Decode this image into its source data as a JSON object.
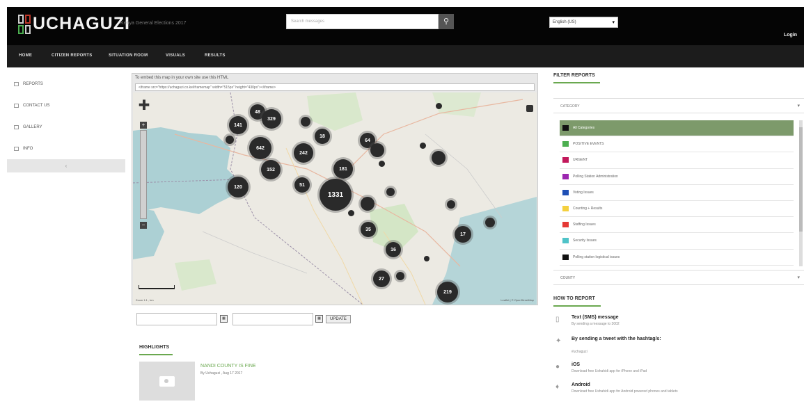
{
  "header": {
    "logo_text": "UCHAGUZI",
    "tagline": "Kenya General Elections 2017",
    "search_placeholder": "Search messages",
    "search_icon": "search-icon",
    "language": "English (US)",
    "login": "Login"
  },
  "nav": [
    {
      "label": "HOME"
    },
    {
      "label": "CITIZEN REPORTS"
    },
    {
      "label": "SITUATION ROOM"
    },
    {
      "label": "VISUALS"
    },
    {
      "label": "RESULTS"
    }
  ],
  "sidebar": [
    {
      "label": "REPORTS"
    },
    {
      "label": "CONTACT US"
    },
    {
      "label": "GALLERY"
    },
    {
      "label": "INFO"
    }
  ],
  "map": {
    "embed_text": "To embed this map in your own site use this HTML",
    "embed_code": "<iframe src=\"https://uchaguzi.co.ke/iframemap\" width=\"515px\" height=\"430px\"></iframe>",
    "clusters": [
      "48",
      "329",
      "141",
      "642",
      "242",
      "152",
      "181",
      "120",
      "1331",
      "64",
      "18",
      "51",
      "35",
      "16",
      "27",
      "219",
      "17"
    ],
    "footer_left": "Zoom 1:1 , km",
    "footer_right": "Leaflet | © OpenStreetMap"
  },
  "date_filter": {
    "update_label": "UPDATE"
  },
  "highlights": {
    "title": "HIGHLIGHTS",
    "item_title": "NANDI COUNTY IS FINE",
    "item_meta": "By Uchaguzi , Aug 17 2017"
  },
  "filter": {
    "title": "FILTER REPORTS",
    "category_label": "CATEGORY",
    "categories": [
      {
        "label": "All Categories",
        "color": "#111111"
      },
      {
        "label": "POSITIVE EVENTS",
        "color": "#4caf50"
      },
      {
        "label": "URGENT",
        "color": "#c2185b"
      },
      {
        "label": "Polling Station Administration",
        "color": "#9c27b0"
      },
      {
        "label": "Voting Issues",
        "color": "#1e4fb5"
      },
      {
        "label": "Counting + Results",
        "color": "#f4d03f"
      },
      {
        "label": "Staffing Issues",
        "color": "#e53935"
      },
      {
        "label": "Security Issues",
        "color": "#4fc3c8"
      },
      {
        "label": "Polling station logistical issues",
        "color": "#111111"
      }
    ],
    "county_label": "COUNTY"
  },
  "howto": {
    "title": "HOW TO REPORT",
    "items": [
      {
        "title": "Text (SMS) message",
        "sub": "By sending a message to 3002",
        "icon": "phone-icon"
      },
      {
        "title": "By sending a tweet with the hashtag/s:",
        "sub": "#uchaguzi",
        "icon": "twitter-icon"
      },
      {
        "title": "iOS",
        "sub": "Download free Ushahidi app for iPhone and iPad",
        "icon": "apple-icon"
      },
      {
        "title": "Android",
        "sub": "Download free Ushahidi app for Android powered phones and tablets",
        "icon": "android-icon"
      }
    ]
  },
  "colors": {
    "accent": "#6aa84f",
    "header_bg": "#050505",
    "nav_bg": "#1c1c1c"
  }
}
